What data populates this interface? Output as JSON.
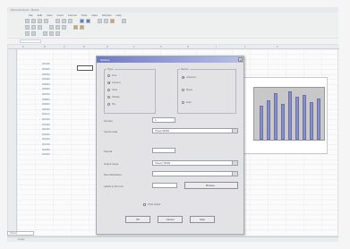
{
  "window": {
    "title": "Microsoft Excel - Book1"
  },
  "menu": [
    "File",
    "Edit",
    "View",
    "Insert",
    "Format",
    "Tools",
    "Data",
    "Window",
    "Help"
  ],
  "sheet": {
    "columns": [
      "A",
      "B",
      "C",
      "D",
      "E",
      "F",
      "G",
      "H",
      "I",
      "J",
      "K"
    ],
    "cells": [
      "000100",
      "000200",
      "000300",
      "000400",
      "000500",
      "000600",
      "000700",
      "000800",
      "000900",
      "001000",
      "001100",
      "001200",
      "001300",
      "001400",
      "001500",
      "001600",
      "001700",
      "001800",
      "001900"
    ],
    "tab": "Sheet1"
  },
  "dialog": {
    "title": "Options",
    "close": "x",
    "group1": {
      "label": "Type",
      "options": [
        "Line",
        "Column",
        "Area",
        "Scatter",
        "Pie"
      ],
      "selected": 1
    },
    "group2": {
      "label": "Series",
      "options": [
        "Columns",
        "Rows",
        "Auto"
      ],
      "selected": 0
    },
    "field1": {
      "label": "Number",
      "value": "1"
    },
    "field2": {
      "label": "Source data",
      "value": "Sheet1!$A$1"
    },
    "field3": {
      "label": "Interval",
      "value": ""
    },
    "field4": {
      "label": "Output range",
      "value": "Sheet1 !$C$3"
    },
    "field5": {
      "label": "New Worksheet",
      "value": ""
    },
    "field6": {
      "label": "Labels in first row",
      "value": ""
    },
    "browse_label": "Browse...",
    "checkbox_label": "Chart output",
    "ok_label": "OK",
    "cancel_label": "Cancel",
    "help_label": "Help"
  },
  "status": {
    "text": "Ready"
  },
  "colors": {
    "dialog_title_start": "#6f7ac5",
    "chart_bar": "#8a8fc8",
    "chart_plot": "#c8c8c8"
  }
}
